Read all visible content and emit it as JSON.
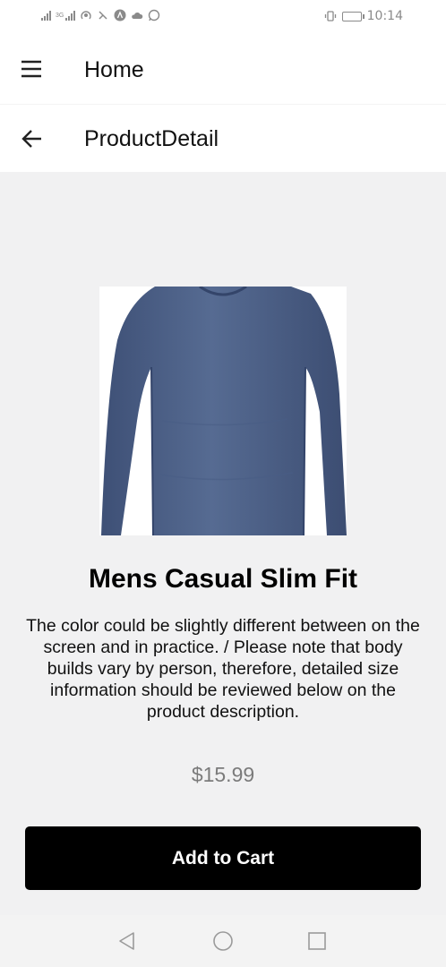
{
  "status_bar": {
    "time": "10:14",
    "left_icons": [
      "signal-icon",
      "signal-3g-icon",
      "hotspot-icon",
      "nfc-icon",
      "a-icon",
      "cloud-icon",
      "whatsapp-icon"
    ],
    "right_icons": [
      "vibrate-icon",
      "battery-icon"
    ],
    "network_label": "3G"
  },
  "app_bar": {
    "title": "Home",
    "menu_icon": "menu-icon"
  },
  "sub_bar": {
    "title": "ProductDetail",
    "back_icon": "back-arrow-icon"
  },
  "product": {
    "name": "Mens Casual Slim Fit",
    "description": "The color could be slightly different between on the screen and in practice. / Please note that body builds vary by person, therefore, detailed size information should be reviewed below on the product description.",
    "price": "$15.99",
    "image": "long-sleeve-tshirt-image",
    "image_color": "#4b5f84"
  },
  "actions": {
    "add_to_cart": "Add to Cart"
  },
  "nav_bar": {
    "icons": [
      "nav-back-icon",
      "nav-home-icon",
      "nav-recents-icon"
    ]
  },
  "colors": {
    "background": "#f1f1f2",
    "button": "#000000",
    "price": "#7b7b7b"
  }
}
